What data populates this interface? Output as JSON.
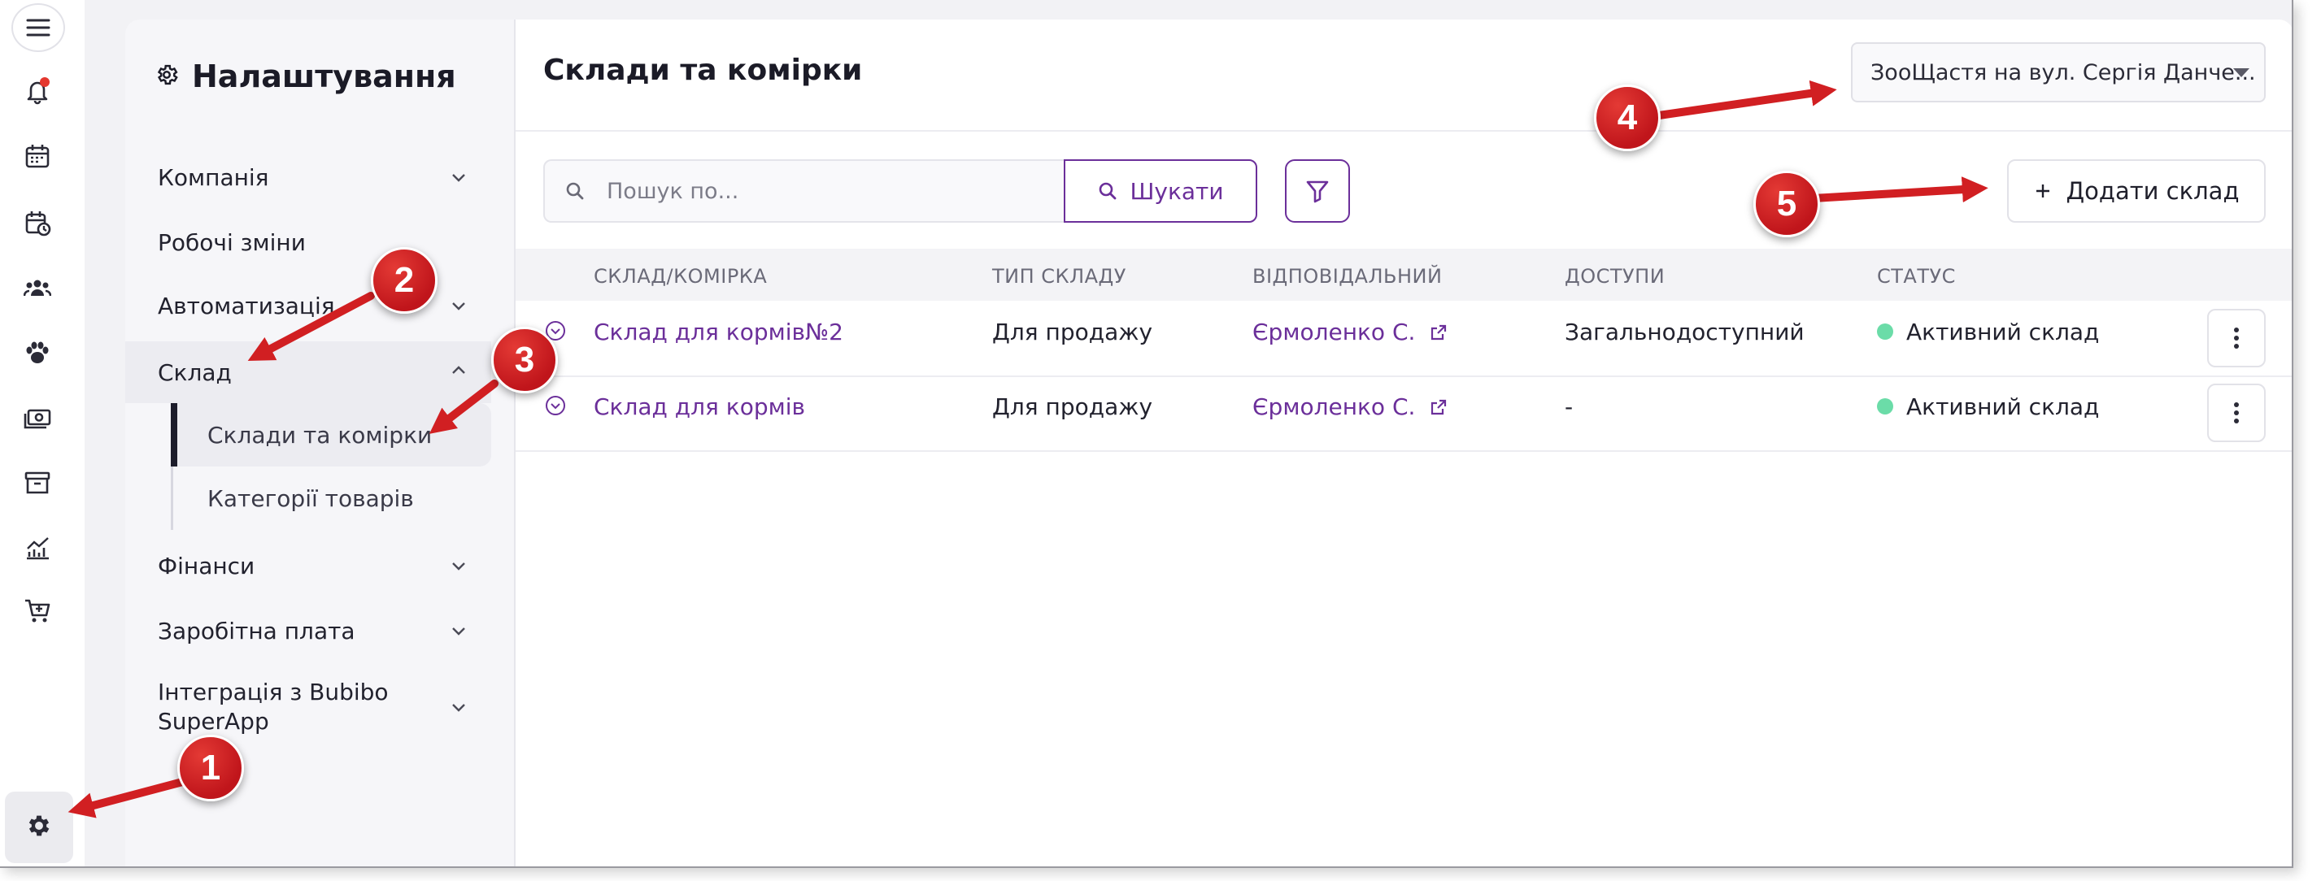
{
  "sidebar": {
    "title": "Налаштування",
    "items": [
      {
        "label": "Компанія"
      },
      {
        "label": "Робочі зміни"
      },
      {
        "label": "Автоматизація"
      },
      {
        "label": "Склад"
      },
      {
        "label": "Фінанси"
      },
      {
        "label": "Заробітна плата"
      },
      {
        "label": "Інтеграція з Bubibo SuperApp"
      }
    ],
    "sub_items": [
      {
        "label": "Склади та комірки"
      },
      {
        "label": "Категорії товарів"
      }
    ]
  },
  "main": {
    "title": "Склади та комірки",
    "location": "ЗооЩастя на вул. Сергія Данче...",
    "search": {
      "placeholder": "Пошук по...",
      "button": "Шукати"
    },
    "add_button": "Додати склад",
    "table": {
      "columns": [
        "СКЛАД/КОМІРКА",
        "ТИП СКЛАДУ",
        "ВІДПОВІДАЛЬНИЙ",
        "ДОСТУПИ",
        "СТАТУС"
      ],
      "rows": [
        {
          "name": "Склад для кормів№2",
          "type": "Для продажу",
          "responsible": "Єрмоленко С.",
          "access": "Загальнодоступний",
          "status": "Активний склад"
        },
        {
          "name": "Склад для кормів",
          "type": "Для продажу",
          "responsible": "Єрмоленко С.",
          "access": "-",
          "status": "Активний склад"
        }
      ]
    }
  },
  "annotations": [
    "1",
    "2",
    "3",
    "4",
    "5"
  ],
  "colors": {
    "accent": "#6b2f9a",
    "status_active": "#6bdca8",
    "annotation": "#d11f22",
    "notification_dot": "#e4382f"
  },
  "icons": [
    "menu-icon",
    "bell-icon",
    "calendar-icon",
    "calendar-clock-icon",
    "users-icon",
    "paw-icon",
    "money-icon",
    "archive-icon",
    "chart-icon",
    "cart-icon",
    "gear-icon"
  ]
}
